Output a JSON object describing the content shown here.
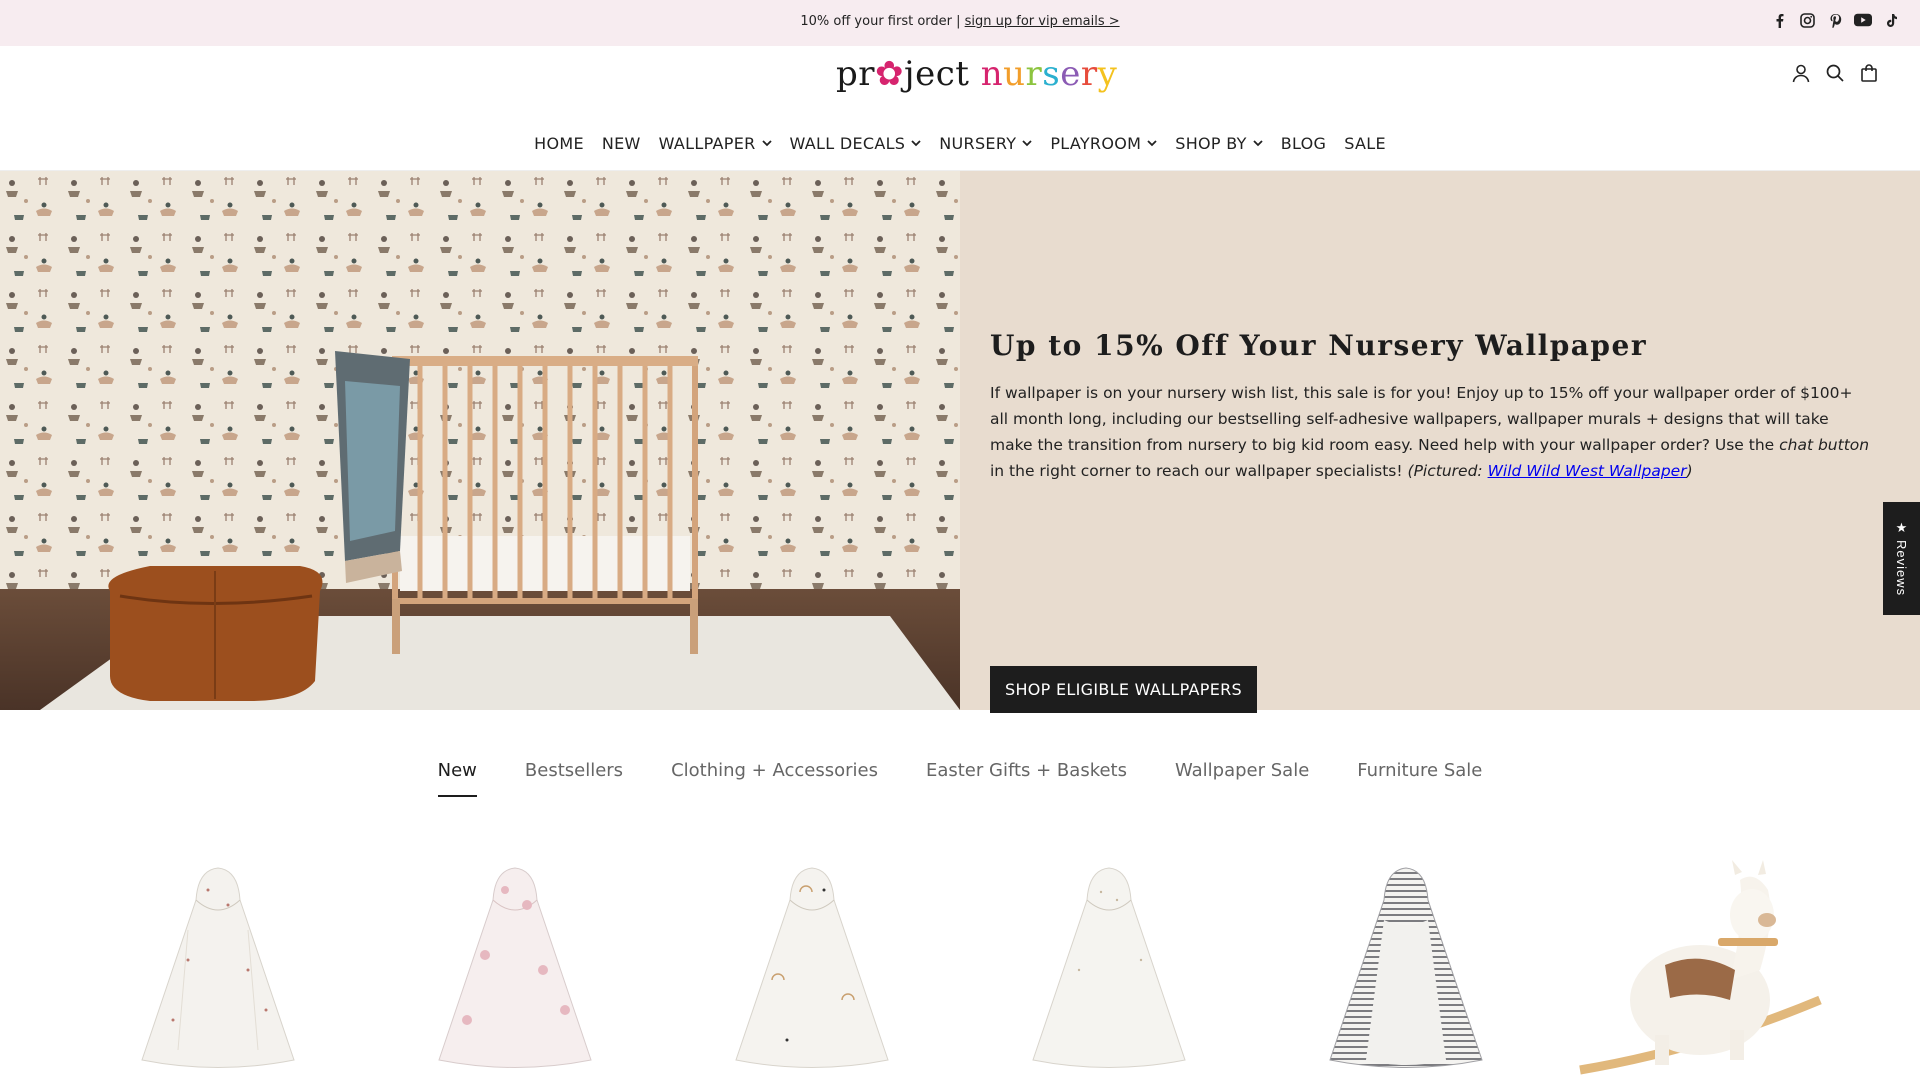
{
  "announcement": {
    "text": "10% off your first order | ",
    "link": "sign up for vip emails >"
  },
  "social_icons": [
    "facebook-icon",
    "instagram-icon",
    "pinterest-icon",
    "youtube-icon",
    "tiktok-icon"
  ],
  "logo": {
    "part1": "pr",
    "part2": "ject",
    "letters": [
      "n",
      "u",
      "r",
      "s",
      "e",
      "r",
      "y"
    ]
  },
  "header_icons": [
    "account-icon",
    "search-icon",
    "cart-icon"
  ],
  "nav": [
    {
      "label": "HOME",
      "dropdown": false
    },
    {
      "label": "NEW",
      "dropdown": false
    },
    {
      "label": "WALLPAPER",
      "dropdown": true
    },
    {
      "label": "WALL DECALS",
      "dropdown": true
    },
    {
      "label": "NURSERY",
      "dropdown": true
    },
    {
      "label": "PLAYROOM",
      "dropdown": true
    },
    {
      "label": "SHOP BY",
      "dropdown": true
    },
    {
      "label": "BLOG",
      "dropdown": false
    },
    {
      "label": "SALE",
      "dropdown": false
    }
  ],
  "hero": {
    "title": "Up to 15% Off Your Nursery Wallpaper",
    "body_1": "If wallpaper is on your nursery wish list, this sale is for you! Enjoy up to 15% off your wallpaper order of $100+ all month long, including our bestselling self-adhesive wallpapers, wallpaper murals + designs that will take make the transition from nursery to big kid room easy. Need help with your wallpaper order? Use the ",
    "body_em": "chat button",
    "body_2": " in the right corner to reach our wallpaper specialists! ",
    "pictured_prefix": "(Pictured: ",
    "pictured_link": "Wild Wild West Wallpaper",
    "pictured_suffix": ")",
    "button": "SHOP ELIGIBLE WALLPAPERS"
  },
  "reviews_tab": {
    "star": "★",
    "label": "Reviews"
  },
  "tabs": [
    {
      "label": "New",
      "active": true
    },
    {
      "label": "Bestsellers",
      "active": false
    },
    {
      "label": "Clothing + Accessories",
      "active": false
    },
    {
      "label": "Easter Gifts + Baskets",
      "active": false
    },
    {
      "label": "Wallpaper Sale",
      "active": false
    },
    {
      "label": "Furniture Sale",
      "active": false
    }
  ],
  "colors": {
    "announce_bg": "#f7ecf0",
    "hero_bg": "#e8dccf",
    "button_bg": "#1d1d1d"
  }
}
